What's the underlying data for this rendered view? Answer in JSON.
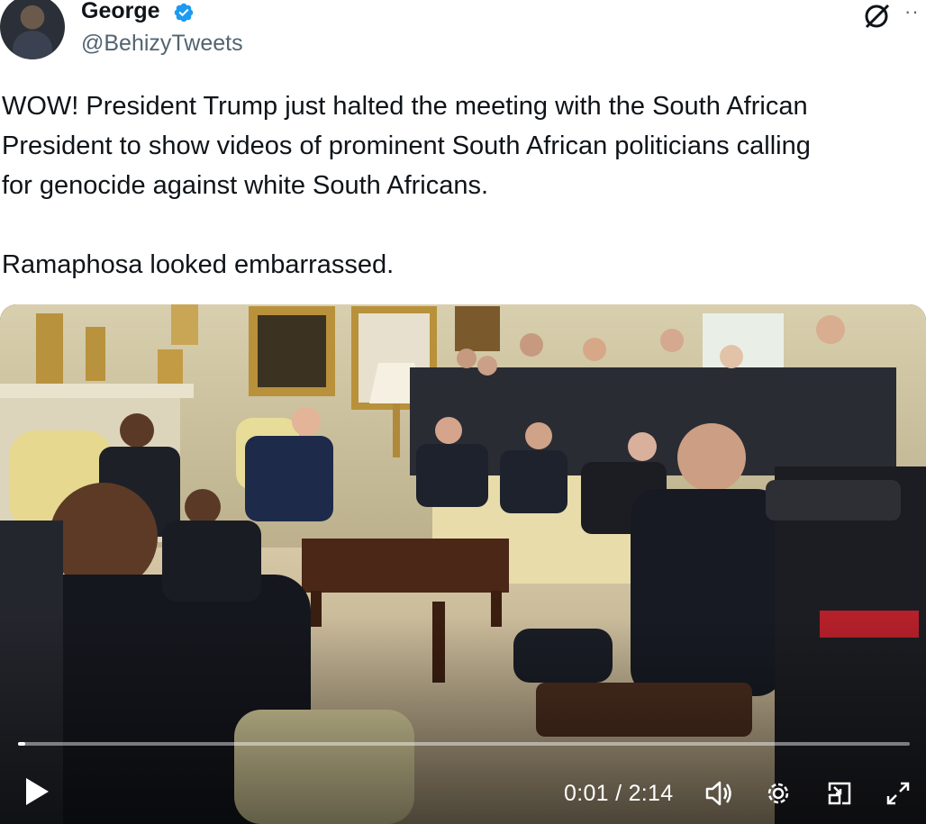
{
  "author": {
    "name": "George",
    "handle": "@BehizyTweets",
    "verified_color": "#1d9bf0"
  },
  "icons": {
    "verified": "verified-badge-icon",
    "grok": "grok-icon",
    "more": "more-icon",
    "play": "play-icon",
    "volume": "volume-icon",
    "settings": "settings-gear-icon",
    "pip": "picture-in-picture-icon",
    "fullscreen": "fullscreen-icon"
  },
  "tweet": {
    "line1": "WOW! President Trump just halted the meeting with the South African",
    "line2": "President to show videos of prominent South African politicians calling",
    "line3": "for genocide against white South Africans.",
    "line4": "Ramaphosa looked embarrassed."
  },
  "video": {
    "time_display": "0:01 / 2:14",
    "progress": 0.008
  }
}
